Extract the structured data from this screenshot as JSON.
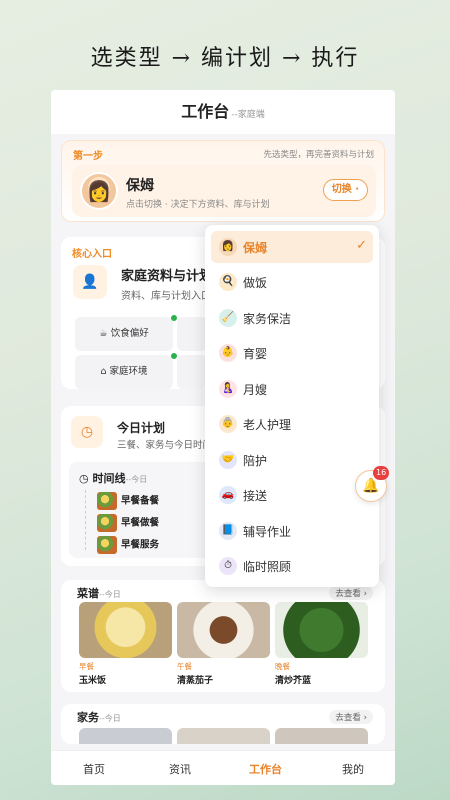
{
  "headline": "选类型 → 编计划 → 执行",
  "header": {
    "title": "工作台",
    "subtitle": "--家庭端"
  },
  "step": {
    "label": "第一步",
    "hint": "先选类型，再完善资料与计划",
    "role_name": "保姆",
    "role_desc": "点击切换 · 决定下方资料、库与计划",
    "switch_label": "切换 ·"
  },
  "core": {
    "label": "核心入口",
    "title": "家庭资料与计划",
    "desc": "资料、库与计划入口",
    "pills": [
      "饮食偏好",
      "家庭环境"
    ]
  },
  "plan": {
    "title": "今日计划",
    "desc": "三餐、家务与今日时间",
    "timeline_title": "时间线",
    "timeline_sub": "--今日",
    "items": [
      "早餐备餐",
      "早餐做餐",
      "早餐服务"
    ]
  },
  "recipes": {
    "title": "菜谱",
    "sub": "--今日",
    "more": "去查看 ›",
    "dishes": [
      {
        "meal": "早餐",
        "name": "玉米饭"
      },
      {
        "meal": "午餐",
        "name": "清蒸茄子"
      },
      {
        "meal": "晚餐",
        "name": "清炒芥蓝"
      }
    ]
  },
  "chores": {
    "title": "家务",
    "sub": "--今日",
    "more": "去查看 ›"
  },
  "tabs": [
    "首页",
    "资讯",
    "工作台",
    "我的"
  ],
  "active_tab": "工作台",
  "dropdown": {
    "options": [
      "保姆",
      "做饭",
      "家务保洁",
      "育婴",
      "月嫂",
      "老人护理",
      "陪护",
      "接送",
      "辅导作业",
      "临时照顾"
    ],
    "selected": "保姆",
    "check": "✓"
  },
  "notifications": {
    "count": "16"
  },
  "colors": {
    "accent": "#e8832a",
    "dot": "#2bb24c",
    "badge": "#e84040"
  }
}
